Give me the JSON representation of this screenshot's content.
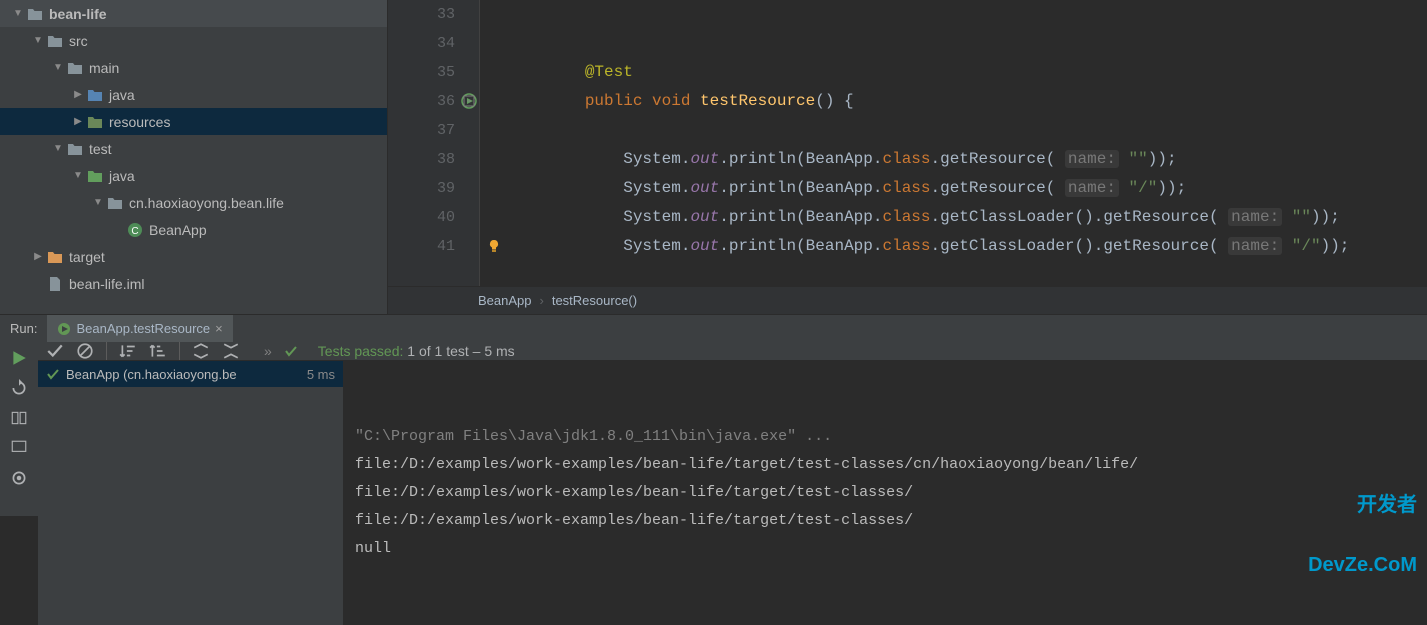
{
  "project_tree": {
    "items": [
      {
        "label": "bean-life",
        "indent": 0,
        "arrow": "down",
        "icon": "folder-gray",
        "bold": true
      },
      {
        "label": "src",
        "indent": 1,
        "arrow": "down",
        "icon": "folder-gray"
      },
      {
        "label": "main",
        "indent": 2,
        "arrow": "down",
        "icon": "folder-gray"
      },
      {
        "label": "java",
        "indent": 3,
        "arrow": "right",
        "icon": "folder-blue"
      },
      {
        "label": "resources",
        "indent": 3,
        "arrow": "right",
        "icon": "folder-resources",
        "selected": true
      },
      {
        "label": "test",
        "indent": 2,
        "arrow": "down",
        "icon": "folder-gray"
      },
      {
        "label": "java",
        "indent": 3,
        "arrow": "down",
        "icon": "folder-green"
      },
      {
        "label": "cn.haoxiaoyong.bean.life",
        "indent": 4,
        "arrow": "down",
        "icon": "folder-gray"
      },
      {
        "label": "BeanApp",
        "indent": 5,
        "arrow": "none",
        "icon": "class-test"
      },
      {
        "label": "target",
        "indent": 1,
        "arrow": "right",
        "icon": "folder-orange"
      },
      {
        "label": "bean-life.iml",
        "indent": 1,
        "arrow": "none",
        "icon": "file"
      }
    ]
  },
  "editor": {
    "gutter": [
      "33",
      "34",
      "35",
      "36",
      "37",
      "38",
      "39",
      "40",
      "41"
    ],
    "run_marker_line": 3,
    "bulb_line": 8,
    "code": {
      "lines": [
        {
          "tokens": []
        },
        {
          "tokens": []
        },
        {
          "tokens": [
            {
              "t": "anno",
              "v": "        @Test"
            }
          ]
        },
        {
          "tokens": [
            {
              "t": "kw",
              "v": "        public void "
            },
            {
              "t": "method",
              "v": "testResource"
            },
            {
              "t": "plain",
              "v": "() {"
            }
          ]
        },
        {
          "tokens": []
        },
        {
          "tokens": [
            {
              "t": "plain",
              "v": "            System."
            },
            {
              "t": "field",
              "v": "out"
            },
            {
              "t": "plain",
              "v": ".println(BeanApp."
            },
            {
              "t": "kw",
              "v": "class"
            },
            {
              "t": "plain",
              "v": ".getResource( "
            },
            {
              "t": "hint",
              "v": "name:"
            },
            {
              "t": "plain",
              "v": " "
            },
            {
              "t": "str",
              "v": "\"\""
            },
            {
              "t": "plain",
              "v": "));"
            }
          ]
        },
        {
          "tokens": [
            {
              "t": "plain",
              "v": "            System."
            },
            {
              "t": "field",
              "v": "out"
            },
            {
              "t": "plain",
              "v": ".println(BeanApp."
            },
            {
              "t": "kw",
              "v": "class"
            },
            {
              "t": "plain",
              "v": ".getResource( "
            },
            {
              "t": "hint",
              "v": "name:"
            },
            {
              "t": "plain",
              "v": " "
            },
            {
              "t": "str",
              "v": "\"/\""
            },
            {
              "t": "plain",
              "v": "));"
            }
          ]
        },
        {
          "tokens": [
            {
              "t": "plain",
              "v": "            System."
            },
            {
              "t": "field",
              "v": "out"
            },
            {
              "t": "plain",
              "v": ".println(BeanApp."
            },
            {
              "t": "kw",
              "v": "class"
            },
            {
              "t": "plain",
              "v": ".getClassLoader().getResource( "
            },
            {
              "t": "hint",
              "v": "name:"
            },
            {
              "t": "plain",
              "v": " "
            },
            {
              "t": "str",
              "v": "\"\""
            },
            {
              "t": "plain",
              "v": "));"
            }
          ]
        },
        {
          "tokens": [
            {
              "t": "plain",
              "v": "            System."
            },
            {
              "t": "field",
              "v": "out"
            },
            {
              "t": "plain",
              "v": ".println(BeanApp."
            },
            {
              "t": "kw",
              "v": "class"
            },
            {
              "t": "plain",
              "v": ".getClassLoader().getResource( "
            },
            {
              "t": "hint",
              "v": "name:"
            },
            {
              "t": "plain",
              "v": " "
            },
            {
              "t": "str",
              "v": "\"/\""
            },
            {
              "t": "plain",
              "v": "));"
            }
          ]
        }
      ]
    },
    "breadcrumb": {
      "class": "BeanApp",
      "method": "testResource()"
    }
  },
  "run": {
    "label": "Run:",
    "tab": "BeanApp.testResource",
    "summary_prefix": "Tests passed:",
    "summary_rest": "1 of 1 test – 5 ms",
    "test_row": {
      "name": "BeanApp (cn.haoxiaoyong.be",
      "time": "5 ms"
    },
    "console": [
      {
        "cls": "dim",
        "text": "\"C:\\Program Files\\Java\\jdk1.8.0_111\\bin\\java.exe\" ..."
      },
      {
        "cls": "",
        "text": "file:/D:/examples/work-examples/bean-life/target/test-classes/cn/haoxiaoyong/bean/life/"
      },
      {
        "cls": "",
        "text": "file:/D:/examples/work-examples/bean-life/target/test-classes/"
      },
      {
        "cls": "",
        "text": "file:/D:/examples/work-examples/bean-life/target/test-classes/"
      },
      {
        "cls": "",
        "text": "null"
      }
    ],
    "watermark": {
      "line1": "开发者",
      "line2": "DevZe.CoM"
    }
  }
}
